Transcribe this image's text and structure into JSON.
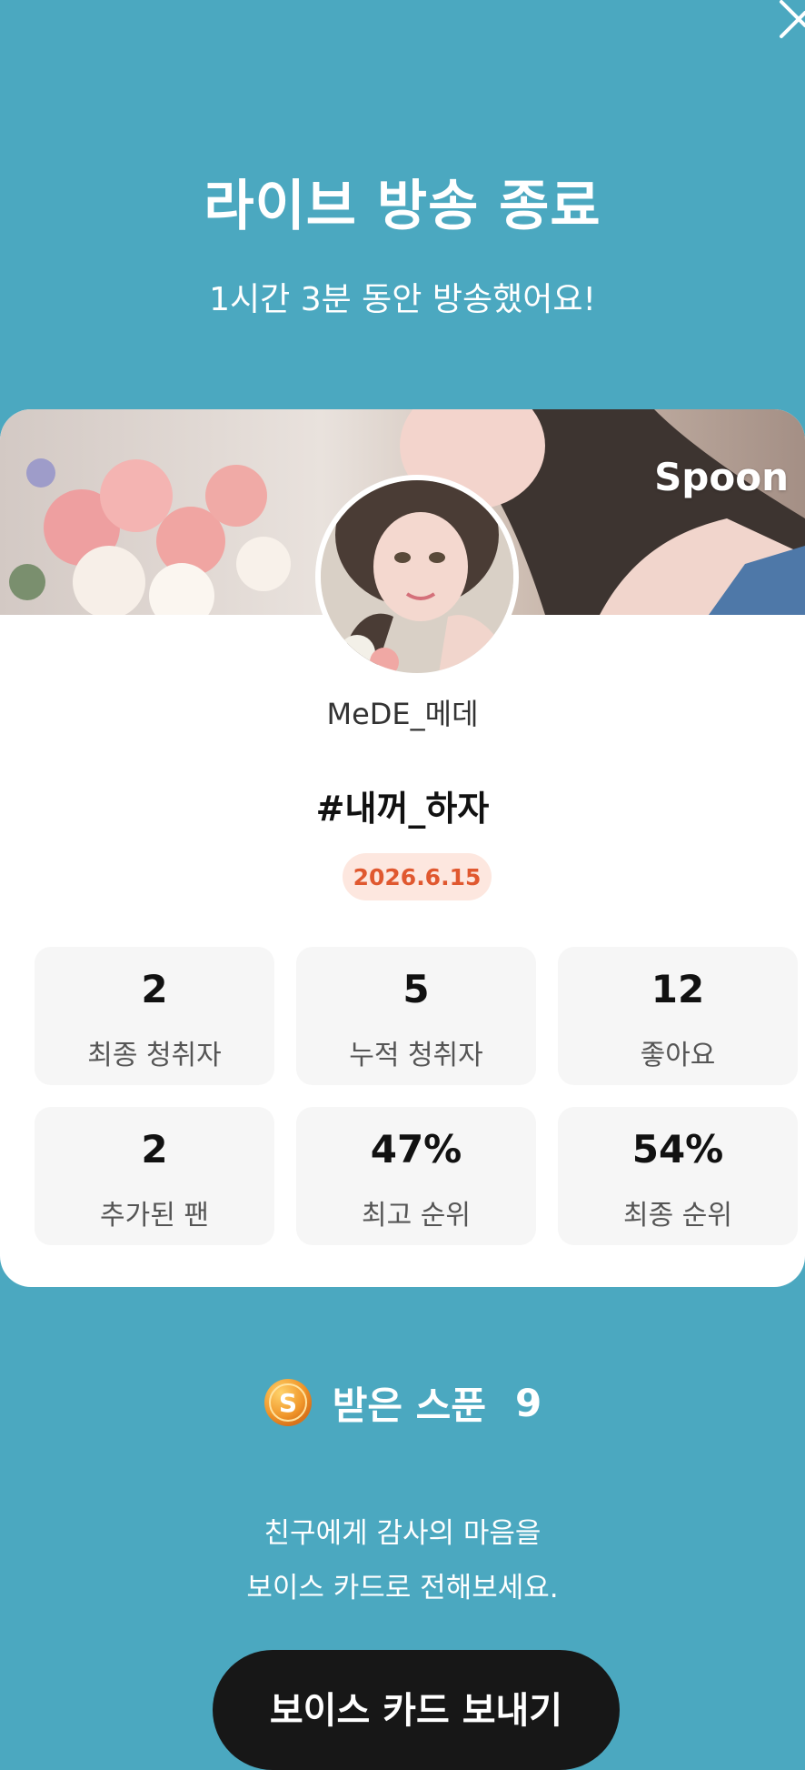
{
  "header": {
    "title": "라이브 방송 종료",
    "subtitle": "1시간 3분 동안 방송했어요!"
  },
  "icons": {
    "close": "close-icon",
    "spoon": "spoon-coin-icon"
  },
  "banner": {
    "brand": "Spoon"
  },
  "profile": {
    "username": "MeDE_메데",
    "hashtag": "#내꺼_하자",
    "date": "2026.6.15"
  },
  "stats": [
    {
      "value": "2",
      "label": "최종 청취자"
    },
    {
      "value": "5",
      "label": "누적 청취자"
    },
    {
      "value": "12",
      "label": "좋아요"
    },
    {
      "value": "2",
      "label": "추가된 팬"
    },
    {
      "value": "47%",
      "label": "최고 순위"
    },
    {
      "value": "54%",
      "label": "최종 순위"
    }
  ],
  "spoons": {
    "label": "받은 스푼",
    "count": "9"
  },
  "message": {
    "line1": "친구에게 감사의 마음을",
    "line2": "보이스 카드로 전해보세요."
  },
  "cta": {
    "label": "보이스 카드 보내기"
  },
  "colors": {
    "background": "#4ba8c0",
    "date_badge_bg": "#fde7df",
    "date_badge_text": "#e0582f",
    "cta_bg": "#171717"
  }
}
